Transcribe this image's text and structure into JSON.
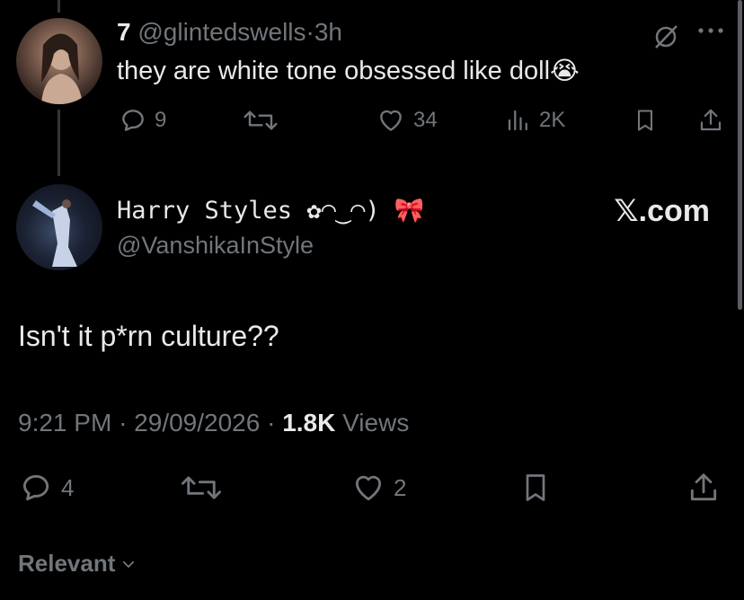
{
  "reply_tweet": {
    "display_name": "7",
    "handle": "@glintedswells",
    "separator": "·",
    "time": "3h",
    "text": "they are white tone obsessed like doll",
    "emoji": "😭",
    "more_icon": "more-icon",
    "grok_icon": "grok-icon",
    "stats": {
      "replies": "9",
      "likes": "34",
      "views": "2K"
    }
  },
  "quoted_tweet": {
    "display_name": "Harry Styles ✿◠‿◠) 🎀",
    "handle": "@VanshikaInStyle",
    "source": "𝕏.com",
    "text": "Isn't it p*rn culture??",
    "time": "9:21 PM",
    "date": "29/09/2026",
    "separator": "·",
    "views_count": "1.8K",
    "views_label": "Views",
    "stats": {
      "replies": "4",
      "likes": "2"
    }
  },
  "sort": {
    "label": "Relevant"
  },
  "colors": {
    "background": "#000000",
    "text_primary": "#e7e9ea",
    "text_secondary": "#71767b"
  }
}
